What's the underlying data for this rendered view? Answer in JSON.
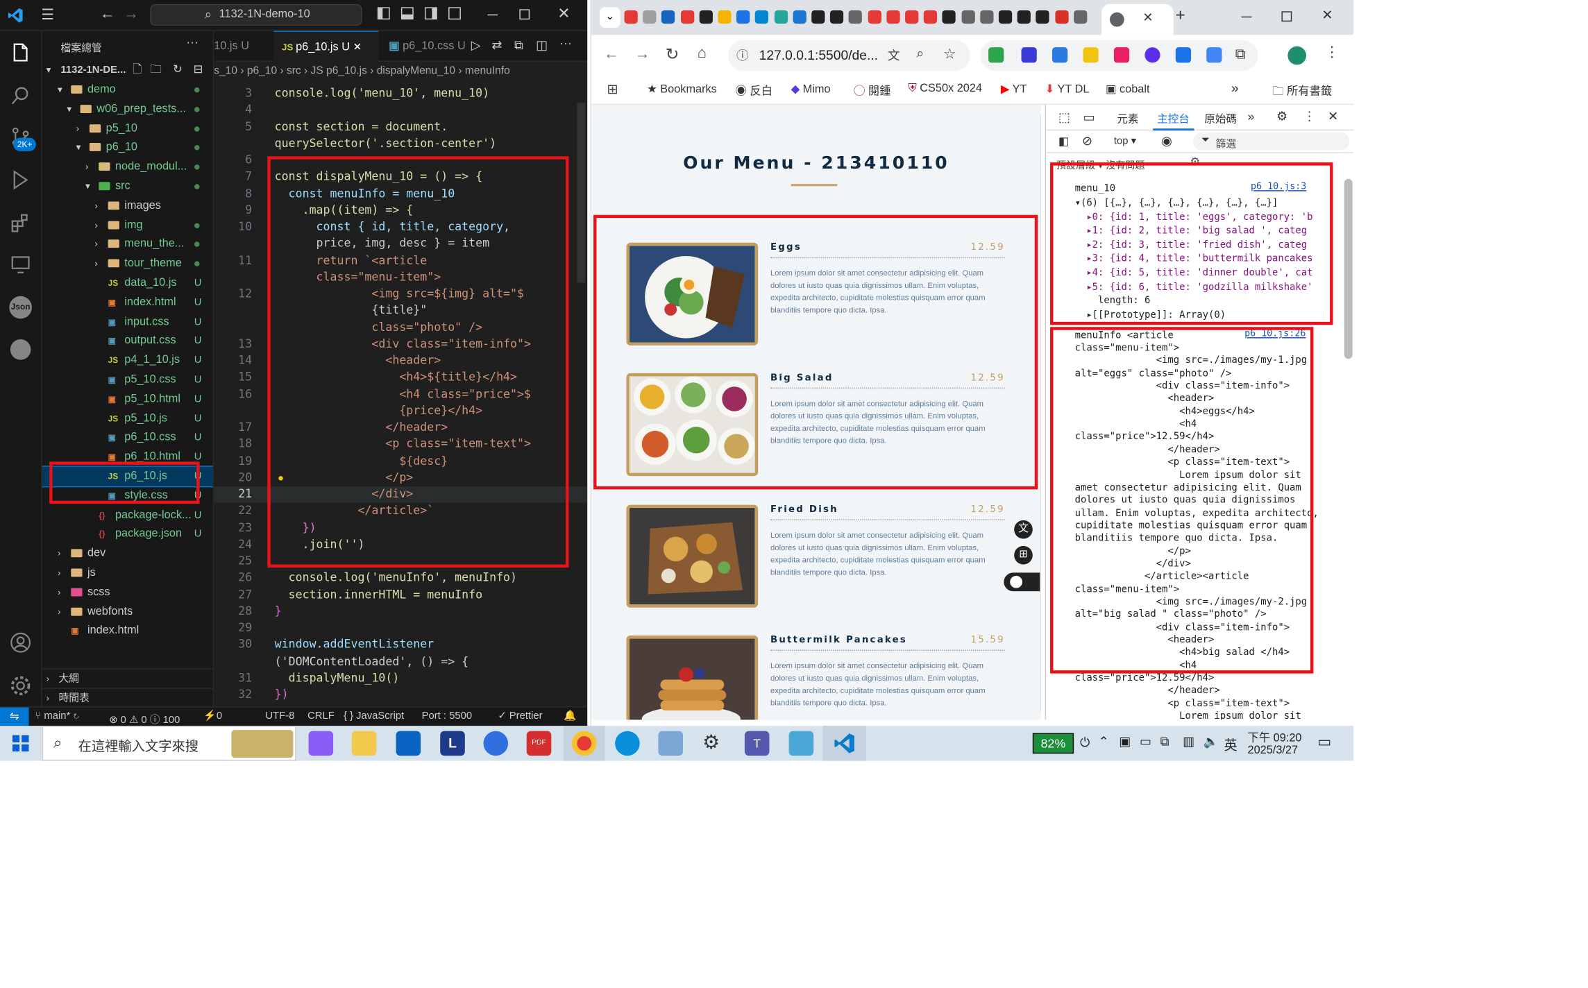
{
  "vscode": {
    "search_text": "1132-1N-demo-10",
    "explorer_title": "檔案總管",
    "workspace": "1132-1N-DE...",
    "tabs": [
      {
        "label": "10.js",
        "badge": "U"
      },
      {
        "label": "p6_10.js",
        "badge": "U"
      },
      {
        "label": "p6_10.css",
        "badge": "U"
      }
    ],
    "breadcrumb": [
      "s_10",
      "p6_10",
      "src",
      "JS p6_10.js",
      "dispalyMenu_10",
      "menuInfo"
    ],
    "tree": [
      {
        "label": "demo",
        "depth": 1,
        "kind": "folder-open",
        "status": "dot"
      },
      {
        "label": "w06_prep_tests...",
        "depth": 2,
        "kind": "folder-open",
        "status": "dot"
      },
      {
        "label": "p5_10",
        "depth": 3,
        "kind": "folder",
        "status": "dot"
      },
      {
        "label": "p6_10",
        "depth": 3,
        "kind": "folder-open",
        "status": "dot"
      },
      {
        "label": "node_modul...",
        "depth": 4,
        "kind": "folder",
        "status": "dot"
      },
      {
        "label": "src",
        "depth": 4,
        "kind": "folder-open-green",
        "status": "dot"
      },
      {
        "label": "images",
        "depth": 5,
        "kind": "folder",
        "status": ""
      },
      {
        "label": "img",
        "depth": 5,
        "kind": "folder",
        "status": "dot"
      },
      {
        "label": "menu_the...",
        "depth": 5,
        "kind": "folder",
        "status": "dot"
      },
      {
        "label": "tour_theme",
        "depth": 5,
        "kind": "folder",
        "status": "dot"
      },
      {
        "label": "data_10.js",
        "depth": 5,
        "kind": "js",
        "status": "U"
      },
      {
        "label": "index.html",
        "depth": 5,
        "kind": "html",
        "status": "U"
      },
      {
        "label": "input.css",
        "depth": 5,
        "kind": "css",
        "status": "U"
      },
      {
        "label": "output.css",
        "depth": 5,
        "kind": "css",
        "status": "U"
      },
      {
        "label": "p4_1_10.js",
        "depth": 5,
        "kind": "js",
        "status": "U"
      },
      {
        "label": "p5_10.css",
        "depth": 5,
        "kind": "css",
        "status": "U"
      },
      {
        "label": "p5_10.html",
        "depth": 5,
        "kind": "html",
        "status": "U"
      },
      {
        "label": "p5_10.js",
        "depth": 5,
        "kind": "js",
        "status": "U"
      },
      {
        "label": "p6_10.css",
        "depth": 5,
        "kind": "css",
        "status": "U"
      },
      {
        "label": "p6_10.html",
        "depth": 5,
        "kind": "html",
        "status": "U"
      },
      {
        "label": "p6_10.js",
        "depth": 5,
        "kind": "js",
        "status": "U",
        "selected": true
      },
      {
        "label": "style.css",
        "depth": 5,
        "kind": "css",
        "status": "U"
      },
      {
        "label": "package-lock...",
        "depth": 4,
        "kind": "json",
        "status": "U"
      },
      {
        "label": "package.json",
        "depth": 4,
        "kind": "json",
        "status": "U"
      },
      {
        "label": "dev",
        "depth": 1,
        "kind": "folder",
        "status": ""
      },
      {
        "label": "js",
        "depth": 1,
        "kind": "folder",
        "status": ""
      },
      {
        "label": "scss",
        "depth": 1,
        "kind": "folder-pink",
        "status": ""
      },
      {
        "label": "webfonts",
        "depth": 1,
        "kind": "folder",
        "status": ""
      },
      {
        "label": "index.html",
        "depth": 1,
        "kind": "html",
        "status": ""
      }
    ],
    "outline": "大綱",
    "timeline": "時間表",
    "code": [
      {
        "n": "3",
        "t": "console.log('menu_10', menu_10)"
      },
      {
        "n": "4",
        "t": ""
      },
      {
        "n": "5",
        "t": "const section = document."
      },
      {
        "n": "",
        "t": "querySelector('.section-center')"
      },
      {
        "n": "6",
        "t": ""
      },
      {
        "n": "7",
        "t": "const dispalyMenu_10 = () => {"
      },
      {
        "n": "8",
        "t": "  const menuInfo = menu_10"
      },
      {
        "n": "9",
        "t": "    .map((item) => {"
      },
      {
        "n": "10",
        "t": "      const { id, title, category,"
      },
      {
        "n": "",
        "t": "      price, img, desc } = item"
      },
      {
        "n": "11",
        "t": "      return `<article"
      },
      {
        "n": "",
        "t": "      class=\"menu-item\">"
      },
      {
        "n": "12",
        "t": "              <img src=${img} alt=\"$"
      },
      {
        "n": "",
        "t": "              {title}\""
      },
      {
        "n": "",
        "t": "              class=\"photo\" />"
      },
      {
        "n": "13",
        "t": "              <div class=\"item-info\">"
      },
      {
        "n": "14",
        "t": "                <header>"
      },
      {
        "n": "15",
        "t": "                  <h4>${title}</h4>"
      },
      {
        "n": "16",
        "t": "                  <h4 class=\"price\">$"
      },
      {
        "n": "",
        "t": "                  {price}</h4>"
      },
      {
        "n": "17",
        "t": "                </header>"
      },
      {
        "n": "18",
        "t": "                <p class=\"item-text\">"
      },
      {
        "n": "19",
        "t": "                  ${desc}"
      },
      {
        "n": "20",
        "t": "                </p>"
      },
      {
        "n": "21",
        "t": "              </div>"
      },
      {
        "n": "22",
        "t": "            </article>`"
      },
      {
        "n": "23",
        "t": "    })"
      },
      {
        "n": "24",
        "t": "    .join('')"
      },
      {
        "n": "25",
        "t": ""
      },
      {
        "n": "26",
        "t": "  console.log('menuInfo', menuInfo)"
      },
      {
        "n": "27",
        "t": "  section.innerHTML = menuInfo"
      },
      {
        "n": "28",
        "t": "}"
      },
      {
        "n": "29",
        "t": ""
      },
      {
        "n": "30",
        "t": "window.addEventListener"
      },
      {
        "n": "",
        "t": "('DOMContentLoaded', () => {"
      },
      {
        "n": "31",
        "t": "  dispalyMenu_10()"
      },
      {
        "n": "32",
        "t": "})"
      }
    ],
    "status": {
      "branch": "main*",
      "problems": "⊗ 0 ⚠ 0 ⓘ 100",
      "ports": "⚡0",
      "encoding": "UTF-8",
      "eol": "CRLF",
      "language": "{ } JavaScript",
      "port": "Port : 5500",
      "prettier": "✓ Prettier",
      "badge_2k": "2K+"
    }
  },
  "chrome": {
    "url": "127.0.0.1:5500/de...",
    "bookmarks": [
      "Bookmarks",
      "反白",
      "Mimo",
      "閱鍾",
      "CS50x 2024",
      "YT",
      "YT DL",
      "cobalt"
    ],
    "all_bookmarks": "所有書籤",
    "page": {
      "heading": "Our Menu - 213410110",
      "items": [
        {
          "title": "Eggs",
          "price": "12.59",
          "desc": "Lorem ipsum dolor sit amet consectetur adipisicing elit. Quam dolores ut iusto quas quia dignissimos ullam. Enim voluptas, expedita architecto, cupiditate molestias quisquam error quam blanditiis tempore quo dicta. Ipsa."
        },
        {
          "title": "Big Salad",
          "price": "12.59",
          "desc": "Lorem ipsum dolor sit amet consectetur adipisicing elit. Quam dolores ut iusto quas quia dignissimos ullam. Enim voluptas, expedita architecto, cupiditate molestias quisquam error quam blanditiis tempore quo dicta. Ipsa."
        },
        {
          "title": "Fried Dish",
          "price": "12.59",
          "desc": "Lorem ipsum dolor sit amet consectetur adipisicing elit. Quam dolores ut iusto quas quia dignissimos ullam. Enim voluptas, expedita architecto, cupiditate molestias quisquam error quam blanditiis tempore quo dicta. Ipsa."
        },
        {
          "title": "Buttermilk Pancakes",
          "price": "15.59",
          "desc": "Lorem ipsum dolor sit amet consectetur adipisicing elit. Quam dolores ut iusto quas quia dignissimos ullam. Enim voluptas, expedita architecto, cupiditate molestias quisquam error quam blanditiis tempore quo dicta. Ipsa."
        }
      ]
    },
    "devtools": {
      "tabs": [
        "元素",
        "主控台",
        "原始碼"
      ],
      "context": "top ▾",
      "filter": "篩選",
      "hidden_row": "預設層級 ▾   沒有問題",
      "log1_label": "menu_10",
      "log1_link": "p6_10.js:3",
      "log1_lines": [
        "▾(6) [{…}, {…}, {…}, {…}, {…}, {…}]",
        "  ▸0: {id: 1, title: 'eggs', category: 'b",
        "  ▸1: {id: 2, title: 'big salad ', categ",
        "  ▸2: {id: 3, title: 'fried dish', categ",
        "  ▸3: {id: 4, title: 'buttermilk pancakes",
        "  ▸4: {id: 5, title: 'dinner double', cat",
        "  ▸5: {id: 6, title: 'godzilla milkshake'",
        "    length: 6",
        "  ▸[[Prototype]]: Array(0)"
      ],
      "log2_label": "menuInfo <article",
      "log2_link": "p6_10.js:26",
      "log2_lines": [
        "class=\"menu-item\">",
        "              <img src=./images/my-1.jpg",
        "alt=\"eggs\" class=\"photo\" />",
        "              <div class=\"item-info\">",
        "                <header>",
        "                  <h4>eggs</h4>",
        "                  <h4",
        "class=\"price\">12.59</h4>",
        "                </header>",
        "                <p class=\"item-text\">",
        "                  Lorem ipsum dolor sit",
        "amet consectetur adipisicing elit. Quam",
        "dolores ut iusto quas quia dignissimos",
        "ullam. Enim voluptas, expedita architecto,",
        "cupiditate molestias quisquam error quam",
        "blanditiis tempore quo dicta. Ipsa.",
        "                </p>",
        "              </div>",
        "            </article><article",
        "class=\"menu-item\">",
        "              <img src=./images/my-2.jpg",
        "alt=\"big salad \" class=\"photo\" />",
        "              <div class=\"item-info\">",
        "                <header>",
        "                  <h4>big salad </h4>",
        "                  <h4",
        "class=\"price\">12.59</h4>",
        "                </header>",
        "                <p class=\"item-text\">",
        "                  Lorem ipsum dolor sit"
      ]
    }
  },
  "taskbar": {
    "search_placeholder": "在這裡輸入文字來搜",
    "battery": "82%",
    "ime": "英",
    "time": "下午 09:20",
    "date": "2025/3/27"
  }
}
